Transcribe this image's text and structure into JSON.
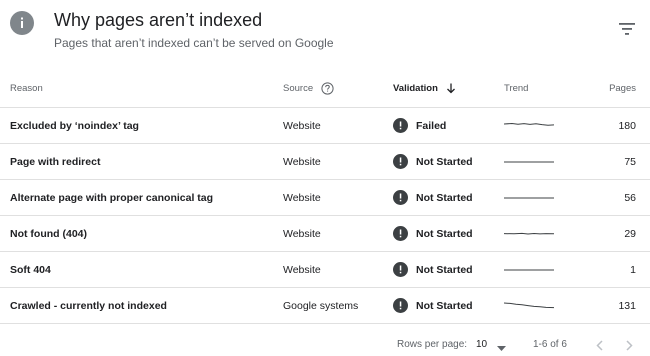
{
  "header": {
    "title": "Why pages aren’t indexed",
    "subtitle": "Pages that aren’t indexed can’t be served on Google",
    "info_icon": "info-icon",
    "filter_icon": "filter-icon"
  },
  "table": {
    "columns": {
      "reason": "Reason",
      "source": "Source",
      "validation": "Validation",
      "trend": "Trend",
      "pages": "Pages"
    },
    "rows": [
      {
        "reason": "Excluded by ‘noindex’ tag",
        "source": "Website",
        "validation": "Failed",
        "trend": "wavy",
        "pages": "180"
      },
      {
        "reason": "Page with redirect",
        "source": "Website",
        "validation": "Not Started",
        "trend": "flat",
        "pages": "75"
      },
      {
        "reason": "Alternate page with proper canonical tag",
        "source": "Website",
        "validation": "Not Started",
        "trend": "flat",
        "pages": "56"
      },
      {
        "reason": "Not found (404)",
        "source": "Website",
        "validation": "Not Started",
        "trend": "slight",
        "pages": "29"
      },
      {
        "reason": "Soft 404",
        "source": "Website",
        "validation": "Not Started",
        "trend": "flat",
        "pages": "1"
      },
      {
        "reason": "Crawled - currently not indexed",
        "source": "Google systems",
        "validation": "Not Started",
        "trend": "declining",
        "pages": "131"
      }
    ]
  },
  "footer": {
    "rows_per_page_label": "Rows per page:",
    "rows_per_page_value": "10",
    "range": "1-6 of 6"
  },
  "colors": {
    "status_icon": "#3c4043",
    "info_icon_bg": "#80868b",
    "divider": "#e0e0e0"
  }
}
